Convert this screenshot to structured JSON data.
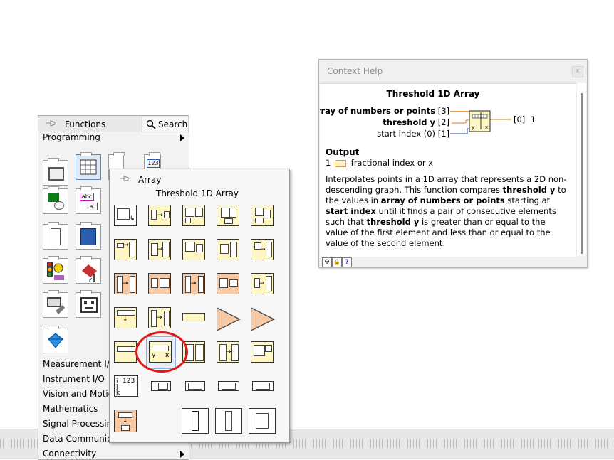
{
  "context_help": {
    "window_title": "Context Help",
    "close_glyph": "x",
    "heading": "Threshold 1D Array",
    "inputs": [
      {
        "label": "array of numbers or points",
        "terminal": "[3]"
      },
      {
        "label": "threshold y",
        "terminal": "[2]"
      },
      {
        "label": "start index (0)",
        "terminal": "[1]"
      }
    ],
    "output_terminal": "[0]",
    "output_terminal_index": "1",
    "output_heading": "Output",
    "output_row_index": "1",
    "output_row_label": "fractional index or x",
    "description_parts": [
      {
        "t": "Interpolates points in a 1D array that represents a 2D non-descending graph. This function compares ",
        "b": false
      },
      {
        "t": "threshold y",
        "b": true
      },
      {
        "t": " to the values in ",
        "b": false
      },
      {
        "t": "array of numbers or points",
        "b": true
      },
      {
        "t": " starting at ",
        "b": false
      },
      {
        "t": "start index",
        "b": true
      },
      {
        "t": " until it finds a pair of consecutive elements such that ",
        "b": false
      },
      {
        "t": "threshold y",
        "b": true
      },
      {
        "t": " is greater than or equal to the value of the first element and less than or equal to the value of the second element.",
        "b": false
      }
    ],
    "bottom_buttons": [
      {
        "icon": "detailed-help-icon",
        "glyph": "⚙"
      },
      {
        "icon": "lock-icon",
        "glyph": "🔒"
      },
      {
        "icon": "help-question-icon",
        "glyph": "?"
      }
    ]
  },
  "functions_palette": {
    "title": "Functions",
    "search_label": "Search",
    "current_category": "Programming",
    "categories": [
      "Measurement I/O",
      "Instrument I/O",
      "Vision and Motion",
      "Mathematics",
      "Signal Processing",
      "Data Communication",
      "Connectivity"
    ],
    "tile_labels": {
      "numeric": "123",
      "string": "abc",
      "string_sub": "a"
    }
  },
  "array_palette": {
    "title": "Array",
    "hover_label": "Threshold 1D Array",
    "build_label": "123",
    "build_sub": [
      "i",
      "j",
      "k"
    ]
  },
  "colors": {
    "highlight_circle": "#e01818",
    "icon_yellow": "#fff6c6",
    "icon_orange": "#f6c9a4",
    "wire_orange": "#e07a10",
    "wire_blue": "#1f3fbf"
  }
}
